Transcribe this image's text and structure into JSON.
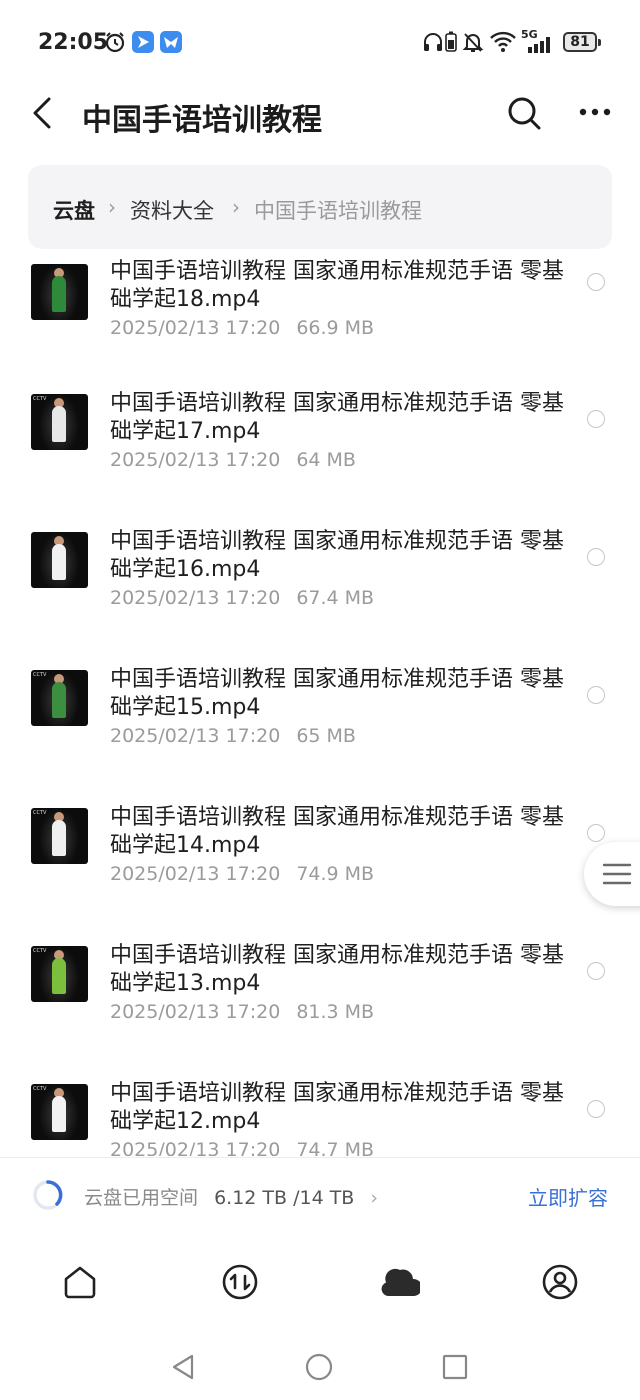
{
  "status_bar": {
    "time": "22:05",
    "network": "5G",
    "battery": "81",
    "icons": [
      "alarm-icon",
      "app-notification-icon",
      "app-notification-icon",
      "headphones-icon",
      "battery-small-icon",
      "mute-bell-icon",
      "wifi-icon",
      "signal-icon"
    ]
  },
  "header": {
    "title": "中国手语培训教程",
    "back_icon": "back-arrow-icon",
    "search_icon": "search-icon",
    "more_icon": "more-icon"
  },
  "breadcrumb": [
    "云盘",
    "资料大全",
    "中国手语培训教程"
  ],
  "files": [
    {
      "name": "中国手语培训教程 国家通用标准规范手语 零基础学起18.mp4",
      "date": "2025/02/13 17:20",
      "size": "66.9 MB"
    },
    {
      "name": "中国手语培训教程 国家通用标准规范手语 零基础学起17.mp4",
      "date": "2025/02/13 17:20",
      "size": "64 MB"
    },
    {
      "name": "中国手语培训教程 国家通用标准规范手语 零基础学起16.mp4",
      "date": "2025/02/13 17:20",
      "size": "67.4 MB"
    },
    {
      "name": "中国手语培训教程 国家通用标准规范手语 零基础学起15.mp4",
      "date": "2025/02/13 17:20",
      "size": "65 MB"
    },
    {
      "name": "中国手语培训教程 国家通用标准规范手语 零基础学起14.mp4",
      "date": "2025/02/13 17:20",
      "size": "74.9 MB"
    },
    {
      "name": "中国手语培训教程 国家通用标准规范手语 零基础学起13.mp4",
      "date": "2025/02/13 17:20",
      "size": "81.3 MB"
    },
    {
      "name": "中国手语培训教程 国家通用标准规范手语 零基础学起12.mp4",
      "date": "2025/02/13 17:20",
      "size": "74.7 MB"
    }
  ],
  "storage": {
    "label": "云盘已用空间",
    "usage": "6.12 TB /14 TB",
    "expand_label": "立即扩容",
    "accent": "#3a6fd8"
  },
  "bottom_nav": [
    "home-icon",
    "transfer-icon",
    "cloud-icon",
    "profile-icon"
  ],
  "system_nav": [
    "back-triangle-icon",
    "home-circle-icon",
    "recents-square-icon"
  ]
}
